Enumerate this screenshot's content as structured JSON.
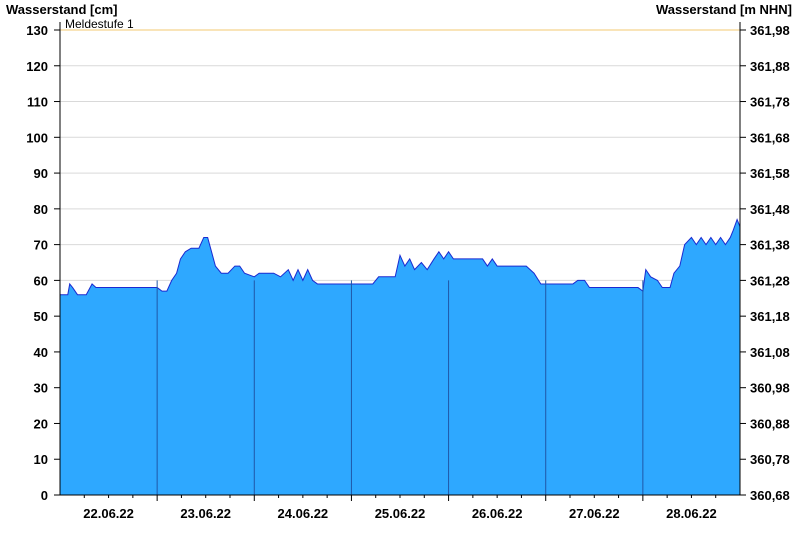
{
  "chart_data": {
    "type": "area",
    "ylabel_left": "Wasserstand [cm]",
    "ylabel_right": "Wasserstand [m NHN]",
    "ylim": [
      0,
      130
    ],
    "yticks_left": [
      0,
      10,
      20,
      30,
      40,
      50,
      60,
      70,
      80,
      90,
      100,
      110,
      120,
      130
    ],
    "yticks_right": [
      "360,68",
      "360,78",
      "360,88",
      "360,98",
      "361,08",
      "361,18",
      "361,28",
      "361,38",
      "361,48",
      "361,58",
      "361,68",
      "361,78",
      "361,88",
      "361,98"
    ],
    "x_tick_labels": [
      "22.06.22",
      "23.06.22",
      "24.06.22",
      "25.06.22",
      "26.06.22",
      "27.06.22",
      "28.06.22"
    ],
    "xlim_days": [
      0,
      7
    ],
    "grid": true,
    "threshold": {
      "label": "Meldestufe 1",
      "value": 130
    },
    "series": [
      {
        "points": [
          [
            0.0,
            56
          ],
          [
            0.08,
            56
          ],
          [
            0.1,
            59
          ],
          [
            0.13,
            58
          ],
          [
            0.18,
            56
          ],
          [
            0.27,
            56
          ],
          [
            0.33,
            59
          ],
          [
            0.37,
            58
          ],
          [
            0.95,
            58
          ],
          [
            1.0,
            58
          ],
          [
            1.05,
            57
          ],
          [
            1.1,
            57
          ],
          [
            1.15,
            60
          ],
          [
            1.2,
            62
          ],
          [
            1.24,
            66
          ],
          [
            1.29,
            68
          ],
          [
            1.35,
            69
          ],
          [
            1.43,
            69
          ],
          [
            1.48,
            72
          ],
          [
            1.52,
            72
          ],
          [
            1.56,
            68
          ],
          [
            1.6,
            64
          ],
          [
            1.66,
            62
          ],
          [
            1.73,
            62
          ],
          [
            1.8,
            64
          ],
          [
            1.85,
            64
          ],
          [
            1.9,
            62
          ],
          [
            2.0,
            61
          ],
          [
            2.05,
            62
          ],
          [
            2.2,
            62
          ],
          [
            2.27,
            61
          ],
          [
            2.35,
            63
          ],
          [
            2.4,
            60
          ],
          [
            2.45,
            63
          ],
          [
            2.5,
            60
          ],
          [
            2.55,
            63
          ],
          [
            2.6,
            60
          ],
          [
            2.65,
            59
          ],
          [
            3.0,
            59
          ],
          [
            3.22,
            59
          ],
          [
            3.28,
            61
          ],
          [
            3.45,
            61
          ],
          [
            3.5,
            67
          ],
          [
            3.55,
            64
          ],
          [
            3.6,
            66
          ],
          [
            3.65,
            63
          ],
          [
            3.72,
            65
          ],
          [
            3.78,
            63
          ],
          [
            3.85,
            66
          ],
          [
            3.9,
            68
          ],
          [
            3.95,
            66
          ],
          [
            4.0,
            68
          ],
          [
            4.05,
            66
          ],
          [
            4.1,
            66
          ],
          [
            4.35,
            66
          ],
          [
            4.4,
            64
          ],
          [
            4.45,
            66
          ],
          [
            4.5,
            64
          ],
          [
            4.8,
            64
          ],
          [
            4.88,
            62
          ],
          [
            4.95,
            59
          ],
          [
            5.0,
            59
          ],
          [
            5.28,
            59
          ],
          [
            5.33,
            60
          ],
          [
            5.4,
            60
          ],
          [
            5.45,
            58
          ],
          [
            5.95,
            58
          ],
          [
            6.0,
            57
          ],
          [
            6.03,
            63
          ],
          [
            6.08,
            61
          ],
          [
            6.15,
            60
          ],
          [
            6.2,
            58
          ],
          [
            6.28,
            58
          ],
          [
            6.32,
            62
          ],
          [
            6.38,
            64
          ],
          [
            6.43,
            70
          ],
          [
            6.5,
            72
          ],
          [
            6.55,
            70
          ],
          [
            6.6,
            72
          ],
          [
            6.65,
            70
          ],
          [
            6.7,
            72
          ],
          [
            6.75,
            70
          ],
          [
            6.8,
            72
          ],
          [
            6.85,
            70
          ],
          [
            6.9,
            72
          ],
          [
            6.93,
            74
          ],
          [
            6.97,
            77
          ],
          [
            7.0,
            75
          ]
        ]
      }
    ],
    "colors": {
      "fill": "#2ea8ff",
      "line": "#1a2ad1",
      "threshold": "#f3c970",
      "day_lines": "#1f57a8",
      "grid": "#d9d9d9"
    }
  }
}
